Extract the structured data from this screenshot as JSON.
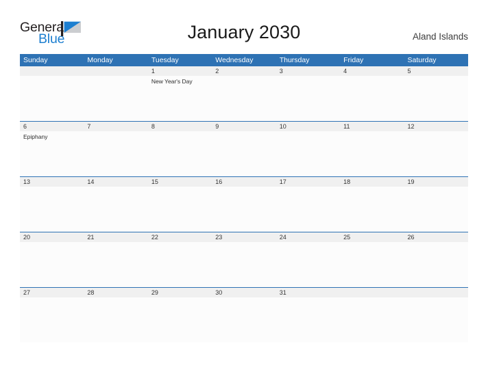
{
  "logo": {
    "word_one": "General",
    "word_two": "Blue",
    "mark": "triangle-flag-icon",
    "colors": {
      "dark": "#231f20",
      "blue": "#1d7fd0",
      "mark": "#1d7fd0"
    }
  },
  "header": {
    "title": "January 2030",
    "region": "Aland Islands"
  },
  "theme": {
    "header_blue": "#2e72b4",
    "separator_blue": "#2e72b4",
    "date_band_gray": "#f0f0f0",
    "cell_white": "#fcfcfc",
    "text_dark": "#333333"
  },
  "calendar": {
    "weekdays": [
      "Sunday",
      "Monday",
      "Tuesday",
      "Wednesday",
      "Thursday",
      "Friday",
      "Saturday"
    ],
    "weeks": [
      [
        {
          "date": "",
          "event": ""
        },
        {
          "date": "",
          "event": ""
        },
        {
          "date": "1",
          "event": "New Year's Day"
        },
        {
          "date": "2",
          "event": ""
        },
        {
          "date": "3",
          "event": ""
        },
        {
          "date": "4",
          "event": ""
        },
        {
          "date": "5",
          "event": ""
        }
      ],
      [
        {
          "date": "6",
          "event": "Epiphany"
        },
        {
          "date": "7",
          "event": ""
        },
        {
          "date": "8",
          "event": ""
        },
        {
          "date": "9",
          "event": ""
        },
        {
          "date": "10",
          "event": ""
        },
        {
          "date": "11",
          "event": ""
        },
        {
          "date": "12",
          "event": ""
        }
      ],
      [
        {
          "date": "13",
          "event": ""
        },
        {
          "date": "14",
          "event": ""
        },
        {
          "date": "15",
          "event": ""
        },
        {
          "date": "16",
          "event": ""
        },
        {
          "date": "17",
          "event": ""
        },
        {
          "date": "18",
          "event": ""
        },
        {
          "date": "19",
          "event": ""
        }
      ],
      [
        {
          "date": "20",
          "event": ""
        },
        {
          "date": "21",
          "event": ""
        },
        {
          "date": "22",
          "event": ""
        },
        {
          "date": "23",
          "event": ""
        },
        {
          "date": "24",
          "event": ""
        },
        {
          "date": "25",
          "event": ""
        },
        {
          "date": "26",
          "event": ""
        }
      ],
      [
        {
          "date": "27",
          "event": ""
        },
        {
          "date": "28",
          "event": ""
        },
        {
          "date": "29",
          "event": ""
        },
        {
          "date": "30",
          "event": ""
        },
        {
          "date": "31",
          "event": ""
        },
        {
          "date": "",
          "event": ""
        },
        {
          "date": "",
          "event": ""
        }
      ]
    ]
  }
}
